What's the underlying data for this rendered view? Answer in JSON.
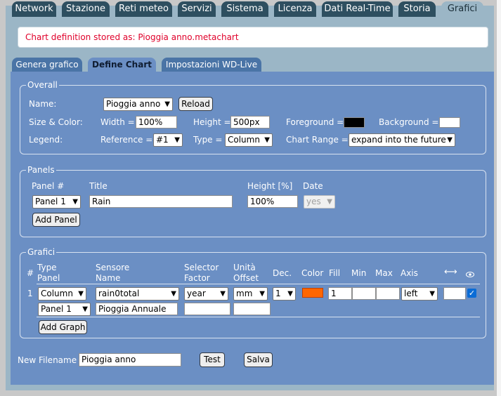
{
  "tabs": [
    "Network",
    "Stazione",
    "Reti meteo",
    "Servizi",
    "Sistema",
    "Licenza",
    "Dati Real-Time",
    "Storia",
    "Grafici"
  ],
  "active_tab": "Grafici",
  "message": "Chart definition stored as: Pioggia anno.metachart",
  "subtabs": [
    "Genera grafico",
    "Define Chart",
    "Impostazioni WD-Live"
  ],
  "active_subtab": "Define Chart",
  "overall": {
    "legend": "Overall",
    "name_label": "Name:",
    "name_value": "Pioggia anno",
    "reload_label": "Reload",
    "size_label": "Size & Color:",
    "width_label": "Width =",
    "width_value": "100%",
    "height_label": "Height =",
    "height_value": "500px",
    "foreground_label": "Foreground =",
    "foreground_color": "#000000",
    "background_label": "Background =",
    "background_color": "#ffffff",
    "legend_label": "Legend:",
    "reference_label": "Reference =",
    "reference_value": "#1",
    "type_label": "Type =",
    "type_value": "Column",
    "range_label": "Chart Range =",
    "range_value": "expand into the future"
  },
  "panels": {
    "legend": "Panels",
    "col_panel": "Panel #",
    "col_title": "Title",
    "col_height": "Height [%]",
    "col_date": "Date",
    "row": {
      "panel": "Panel 1",
      "title": "Rain",
      "height": "100%",
      "date": "yes"
    },
    "add_label": "Add Panel"
  },
  "grafici": {
    "legend": "Grafici",
    "col_hash": "#",
    "col_type": [
      "Type",
      "Panel"
    ],
    "col_sensor": [
      "Sensore",
      "Name"
    ],
    "col_selector": [
      "Selector",
      "Factor"
    ],
    "col_unit": [
      "Unità",
      "Offset"
    ],
    "col_dec": "Dec.",
    "col_color": "Color",
    "col_fill": "Fill",
    "col_min": "Min",
    "col_max": "Max",
    "col_axis": "Axis",
    "row": {
      "index": "1",
      "type": "Column",
      "sensor": "rain0total",
      "selector": "year",
      "unit": "mm",
      "dec": "1",
      "color": "#ff6600",
      "fill": "1",
      "min": "",
      "max": "",
      "axis": "left",
      "panel": "Panel 1",
      "name": "Pioggia Annuale",
      "factor": "",
      "offset": "",
      "visible": true
    },
    "add_label": "Add Graph"
  },
  "footer": {
    "filename_label": "New Filename",
    "filename_value": "Pioggia anno",
    "test_label": "Test",
    "save_label": "Salva"
  }
}
